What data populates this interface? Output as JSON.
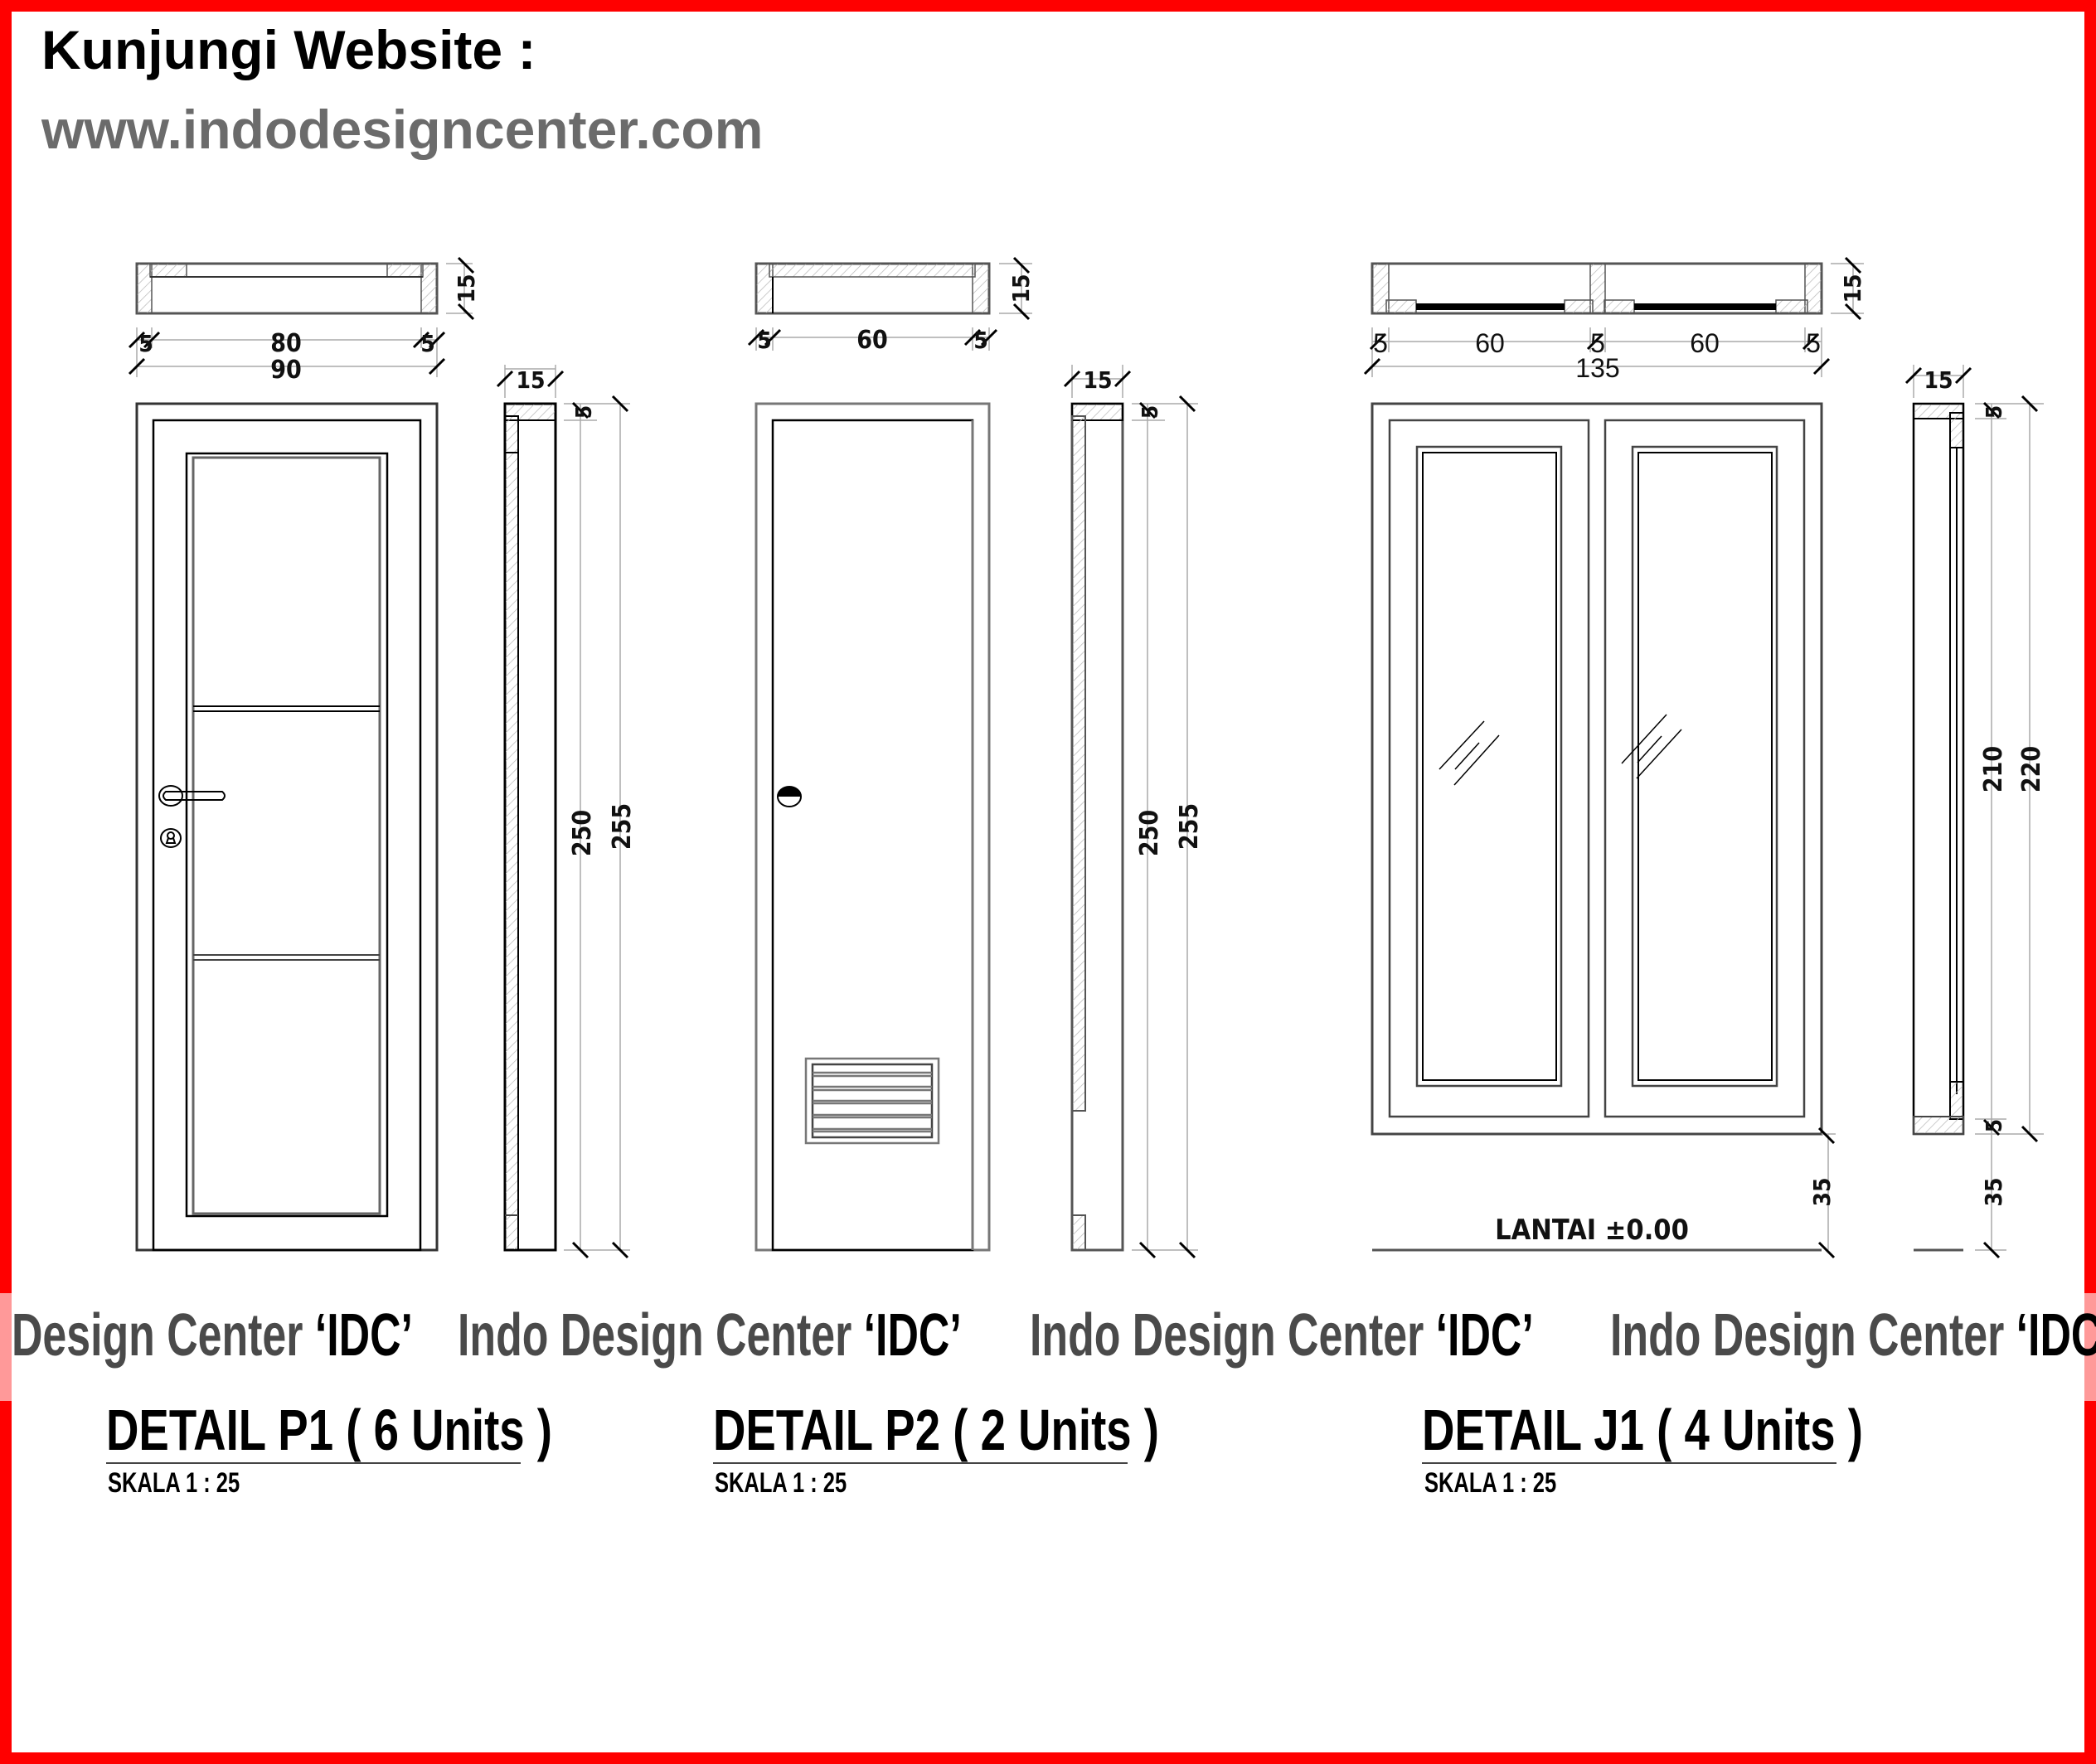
{
  "header": {
    "title": "Kunjungi Website :",
    "url": "www.indodesigncenter.com"
  },
  "watermark": {
    "text": "Indo Design Center ",
    "tag": "‘IDC’",
    "partial_text": "Design Center "
  },
  "details": [
    {
      "id": "P1",
      "title": "DETAIL P1 ( 6 Units )",
      "scale": "SKALA 1 : 25",
      "plan_dims": {
        "left": "5",
        "center": "80",
        "right": "5",
        "total": "90",
        "depth": "15"
      },
      "side_dims": {
        "width": "15",
        "top": "5",
        "height_inner": "250",
        "height_total": "255"
      }
    },
    {
      "id": "P2",
      "title": "DETAIL P2 ( 2 Units )",
      "scale": "SKALA 1 : 25",
      "plan_dims": {
        "left": "5",
        "center": "60",
        "right": "5",
        "depth": "15"
      },
      "side_dims": {
        "width": "15",
        "top": "5",
        "height_inner": "250",
        "height_total": "255"
      }
    },
    {
      "id": "J1",
      "title": "DETAIL J1 ( 4 Units )",
      "scale": "SKALA 1 : 25",
      "plan_dims": {
        "left": "5",
        "leaf1": "60",
        "mid": "5",
        "leaf2": "60",
        "right": "5",
        "total": "135",
        "depth": "15"
      },
      "side_dims": {
        "width": "15",
        "top": "5",
        "bottom": "5",
        "height_inner": "210",
        "height_total": "220",
        "sill": "35"
      },
      "floor_label": "LANTAI ±0.00"
    }
  ],
  "colors": {
    "border": "#ff0000",
    "url_gray": "#6b6b6b",
    "watermark_gray": "#4a4a4a",
    "hatch": "#bbbbbb"
  }
}
